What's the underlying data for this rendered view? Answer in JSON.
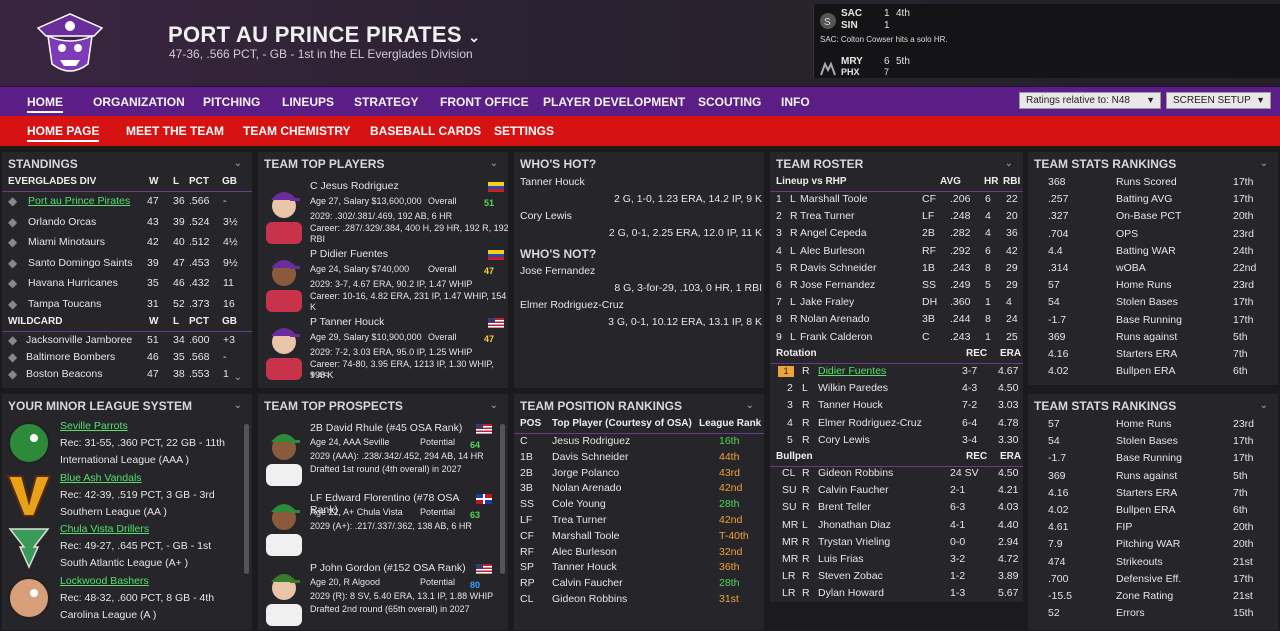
{
  "team": {
    "name": "PORT AU PRINCE PIRATES",
    "record": "47-36, .566 PCT, - GB - 1st in the EL Everglades Division"
  },
  "scoreboard": {
    "game1": {
      "away": "SAC",
      "away_score": "1",
      "inning": "4th",
      "home": "SIN",
      "home_score": "1"
    },
    "play": "SAC: Colton Cowser hits a solo HR.",
    "game2": {
      "away": "MRY",
      "away_score": "6",
      "inning": "5th",
      "home": "PHX",
      "home_score": "7"
    }
  },
  "nav": {
    "items": [
      "HOME",
      "ORGANIZATION",
      "PITCHING",
      "LINEUPS",
      "STRATEGY",
      "FRONT OFFICE",
      "PLAYER DEVELOPMENT",
      "SCOUTING",
      "INFO"
    ],
    "ratings_dropdown": "Ratings relative to: N48",
    "screen_setup": "SCREEN SETUP"
  },
  "subnav": {
    "items": [
      "HOME PAGE",
      "MEET THE TEAM",
      "TEAM CHEMISTRY",
      "BASEBALL CARDS",
      "SETTINGS"
    ]
  },
  "standings": {
    "title": "STANDINGS",
    "div_header": [
      "EVERGLADES DIV",
      "W",
      "L",
      "PCT",
      "GB"
    ],
    "div_rows": [
      [
        "Port au Prince Pirates",
        "47",
        "36",
        ".566",
        "-"
      ],
      [
        "Orlando Orcas",
        "43",
        "39",
        ".524",
        "3½"
      ],
      [
        "Miami Minotaurs",
        "42",
        "40",
        ".512",
        "4½"
      ],
      [
        "Santo Domingo Saints",
        "39",
        "47",
        ".453",
        "9½"
      ],
      [
        "Havana Hurricanes",
        "35",
        "46",
        ".432",
        "11"
      ],
      [
        "Tampa Toucans",
        "31",
        "52",
        ".373",
        "16"
      ]
    ],
    "wc_header": [
      "WILDCARD",
      "W",
      "L",
      "PCT",
      "GB"
    ],
    "wc_rows": [
      [
        "Jacksonville Jamboree",
        "51",
        "34",
        ".600",
        "+3"
      ],
      [
        "Baltimore Bombers",
        "46",
        "35",
        ".568",
        "-"
      ],
      [
        "Boston Beacons",
        "47",
        "38",
        ".553",
        "1"
      ]
    ]
  },
  "top_players": {
    "title": "TEAM TOP PLAYERS",
    "overall_label": "Overall",
    "players": [
      {
        "name": "C Jesus Rodriguez",
        "info": "Age 27, Salary $13,600,000",
        "overall": "51",
        "line1": "2029: .302/.381/.469, 192 AB, 6 HR",
        "line2": "Career: .287/.329/.384, 400 H, 29 HR, 192 R, 192 RBI"
      },
      {
        "name": "P Didier Fuentes",
        "info": "Age 24, Salary $740,000",
        "overall": "47",
        "line1": "2029: 3-7, 4.67 ERA, 90.2 IP, 1.47 WHIP",
        "line2": "Career: 10-16, 4.82 ERA, 231 IP, 1.47 WHIP, 154 K"
      },
      {
        "name": "P Tanner Houck",
        "info": "Age 29, Salary $10,900,000",
        "overall": "47",
        "line1": "2029: 7-2, 3.03 ERA, 95.0 IP, 1.25 WHIP",
        "line2": "Career: 74-80, 3.95 ERA, 1213 IP, 1.30 WHIP, 998 K",
        "line3": "1 AS"
      }
    ]
  },
  "whos_hot": {
    "title": "WHO'S HOT?",
    "rows": [
      {
        "name": "Tanner Houck",
        "line": "2 G, 1-0, 1.23 ERA, 14.2 IP, 9 K"
      },
      {
        "name": "Cory Lewis",
        "line": "2 G, 0-1, 2.25 ERA, 12.0 IP, 11 K"
      }
    ]
  },
  "whos_not": {
    "title": "WHO'S NOT?",
    "rows": [
      {
        "name": "Jose Fernandez",
        "line": "8 G, 3-for-29, .103, 0 HR, 1 RBI"
      },
      {
        "name": "Elmer Rodriguez-Cruz",
        "line": "3 G, 0-1, 10.12 ERA, 13.1 IP, 8 K"
      }
    ]
  },
  "roster": {
    "title": "TEAM ROSTER",
    "lineup_header": [
      "Lineup vs RHP",
      "AVG",
      "HR",
      "RBI"
    ],
    "lineup": [
      [
        "1",
        "L",
        "Marshall Toole",
        "CF",
        ".206",
        "6",
        "22"
      ],
      [
        "2",
        "R",
        "Trea Turner",
        "LF",
        ".248",
        "4",
        "20"
      ],
      [
        "3",
        "R",
        "Angel Cepeda",
        "2B",
        ".282",
        "4",
        "36"
      ],
      [
        "4",
        "L",
        "Alec Burleson",
        "RF",
        ".292",
        "6",
        "42"
      ],
      [
        "5",
        "R",
        "Davis Schneider",
        "1B",
        ".243",
        "8",
        "29"
      ],
      [
        "6",
        "R",
        "Jose Fernandez",
        "SS",
        ".249",
        "5",
        "29"
      ],
      [
        "7",
        "L",
        "Jake Fraley",
        "DH",
        ".360",
        "1",
        "4"
      ],
      [
        "8",
        "R",
        "Nolan Arenado",
        "3B",
        ".244",
        "8",
        "24"
      ],
      [
        "9",
        "L",
        "Frank Calderon",
        "C",
        ".243",
        "1",
        "25"
      ]
    ],
    "rotation_header": [
      "Rotation",
      "REC",
      "ERA"
    ],
    "rotation": [
      [
        "1",
        "R",
        "Didier Fuentes",
        "3-7",
        "4.67"
      ],
      [
        "2",
        "L",
        "Wilkin Paredes",
        "4-3",
        "4.50"
      ],
      [
        "3",
        "R",
        "Tanner Houck",
        "7-2",
        "3.03"
      ],
      [
        "4",
        "R",
        "Elmer Rodriguez-Cruz",
        "6-4",
        "4.78"
      ],
      [
        "5",
        "R",
        "Cory Lewis",
        "3-4",
        "3.30"
      ]
    ],
    "bullpen_header": [
      "Bullpen",
      "REC",
      "ERA"
    ],
    "bullpen": [
      [
        "CL",
        "R",
        "Gideon Robbins",
        "24 SV",
        "4.50"
      ],
      [
        "SU",
        "R",
        "Calvin Faucher",
        "2-1",
        "4.21"
      ],
      [
        "SU",
        "R",
        "Brent Teller",
        "6-3",
        "4.03"
      ],
      [
        "MR",
        "L",
        "Jhonathan Diaz",
        "4-1",
        "4.40"
      ],
      [
        "MR",
        "R",
        "Trystan Vrieling",
        "0-0",
        "2.94"
      ],
      [
        "MR",
        "R",
        "Luis Frias",
        "3-2",
        "4.72"
      ],
      [
        "LR",
        "R",
        "Steven Zobac",
        "1-2",
        "3.89"
      ],
      [
        "LR",
        "R",
        "Dylan Howard",
        "1-3",
        "5.67"
      ]
    ]
  },
  "stats_rankings_1": {
    "title": "TEAM STATS RANKINGS",
    "rows": [
      [
        "368",
        "Runs Scored",
        "17th"
      ],
      [
        ".257",
        "Batting AVG",
        "17th"
      ],
      [
        ".327",
        "On-Base PCT",
        "20th"
      ],
      [
        ".704",
        "OPS",
        "23rd"
      ],
      [
        "4.4",
        "Batting WAR",
        "24th"
      ],
      [
        ".314",
        "wOBA",
        "22nd"
      ],
      [
        "57",
        "Home Runs",
        "23rd"
      ],
      [
        "54",
        "Stolen Bases",
        "17th"
      ],
      [
        "-1.7",
        "Base Running",
        "17th"
      ],
      [
        "369",
        "Runs against",
        "5th"
      ],
      [
        "4.16",
        "Starters ERA",
        "7th"
      ],
      [
        "4.02",
        "Bullpen ERA",
        "6th"
      ]
    ]
  },
  "stats_rankings_2": {
    "title": "TEAM STATS RANKINGS",
    "rows": [
      [
        "57",
        "Home Runs",
        "23rd"
      ],
      [
        "54",
        "Stolen Bases",
        "17th"
      ],
      [
        "-1.7",
        "Base Running",
        "17th"
      ],
      [
        "369",
        "Runs against",
        "5th"
      ],
      [
        "4.16",
        "Starters ERA",
        "7th"
      ],
      [
        "4.02",
        "Bullpen ERA",
        "6th"
      ],
      [
        "4.61",
        "FIP",
        "20th"
      ],
      [
        "7.9",
        "Pitching WAR",
        "20th"
      ],
      [
        "474",
        "Strikeouts",
        "21st"
      ],
      [
        ".700",
        "Defensive Eff.",
        "17th"
      ],
      [
        "-15.5",
        "Zone Rating",
        "21st"
      ],
      [
        "52",
        "Errors",
        "15th"
      ]
    ]
  },
  "minors": {
    "title": "YOUR MINOR LEAGUE SYSTEM",
    "teams": [
      {
        "name": "Seville Parrots",
        "rec": "Rec: 31-55, .360 PCT, 22 GB - 11th",
        "league": "International League (AAA )"
      },
      {
        "name": "Blue Ash Vandals",
        "rec": "Rec: 42-39, .519 PCT, 3 GB - 3rd",
        "league": "Southern League (AA )"
      },
      {
        "name": "Chula Vista Drillers",
        "rec": "Rec: 49-27, .645 PCT, - GB - 1st",
        "league": "South Atlantic League (A+ )"
      },
      {
        "name": "Lockwood Bashers",
        "rec": "Rec: 48-32, .600 PCT, 8 GB - 4th",
        "league": "Carolina League (A )"
      }
    ]
  },
  "prospects": {
    "title": "TEAM TOP PROSPECTS",
    "potential_label": "Potential",
    "players": [
      {
        "name": "2B David Rhule (#45 OSA Rank)",
        "info": "Age 24, AAA Seville",
        "potential": "64",
        "line1": "2029 (AAA): .238/.342/.452, 294 AB, 14 HR",
        "line2": "Drafted 1st round (4th overall) in 2027"
      },
      {
        "name": "LF Edward Florentino (#78 OSA Rank)",
        "info": "Age 22, A+ Chula Vista",
        "potential": "63",
        "line1": "2029 (A+): .217/.337/.362, 138 AB, 6 HR",
        "line2": ""
      },
      {
        "name": "P John Gordon (#152 OSA Rank)",
        "info": "Age 20, R Algood",
        "potential": "80",
        "line1": "2029 (R): 8 SV, 5.40 ERA, 13.1 IP, 1.88 WHIP",
        "line2": "Drafted 2nd round (65th overall) in 2027"
      }
    ]
  },
  "position_rankings": {
    "title": "TEAM POSITION RANKINGS",
    "header": [
      "POS",
      "Top Player (Courtesy of OSA)",
      "League Rank"
    ],
    "rows": [
      [
        "C",
        "Jesus Rodriguez",
        "16th"
      ],
      [
        "1B",
        "Davis Schneider",
        "44th"
      ],
      [
        "2B",
        "Jorge Polanco",
        "43rd"
      ],
      [
        "3B",
        "Nolan Arenado",
        "42nd"
      ],
      [
        "SS",
        "Cole Young",
        "28th"
      ],
      [
        "LF",
        "Trea Turner",
        "42nd"
      ],
      [
        "CF",
        "Marshall Toole",
        "T-40th"
      ],
      [
        "RF",
        "Alec Burleson",
        "32nd"
      ],
      [
        "SP",
        "Tanner Houck",
        "36th"
      ],
      [
        "RP",
        "Calvin Faucher",
        "28th"
      ],
      [
        "CL",
        "Gideon Robbins",
        "31st"
      ]
    ]
  },
  "colors": {
    "accent_purple": "#5b1d86",
    "nav_red": "#d61212",
    "link_green": "#57e06b",
    "rank_orange": "#f2a23a",
    "rank_green": "#55d655"
  }
}
